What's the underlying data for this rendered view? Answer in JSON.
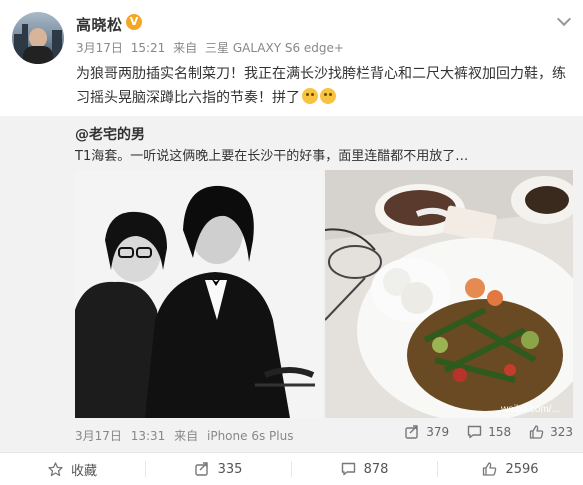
{
  "post": {
    "user_name": "高晓松",
    "vip_badge": "V",
    "date": "3月17日",
    "time": "15:21",
    "source_prefix": "来自",
    "source": "三星 GALAXY S6 edge+",
    "text": "为狼哥两肋插实名制菜刀！我正在满长沙找胯栏背心和二尺大裤衩加回力鞋，练习摇头晃脑深蹲比六指的节奏！拼了"
  },
  "repost": {
    "user": "@老宅的男",
    "text": "T1海套。一听说这俩晚上要在长沙干的好事，面里连醋都不用放了…",
    "date": "3月17日",
    "time": "13:31",
    "source_prefix": "来自",
    "source": "iPhone 6s Plus",
    "repost_count": "379",
    "comment_count": "158",
    "like_count": "323",
    "watermark": "weibo.com/..."
  },
  "footer": {
    "favorite_label": "收藏",
    "repost_count": "335",
    "comment_count": "878",
    "like_count": "2596"
  },
  "colors": {
    "vip_badge": "#f5a623",
    "repost_bg": "#f2f2f2"
  }
}
